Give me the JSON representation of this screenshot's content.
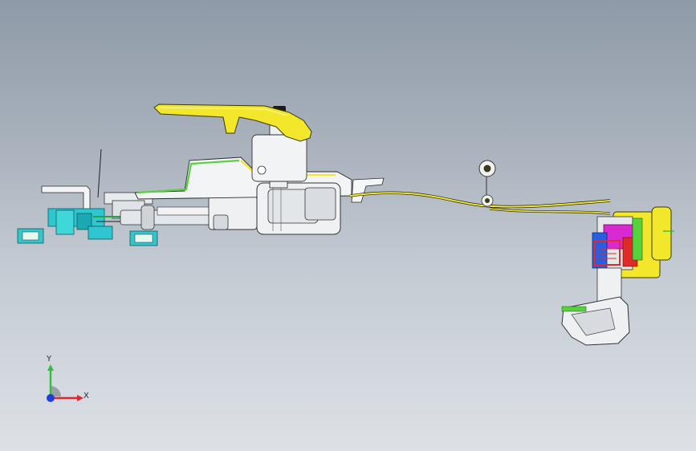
{
  "view": {
    "background_top": "#8f9aa8",
    "background_bottom": "#dde1e6"
  },
  "triad": {
    "y_label": "Y",
    "x_label": "X",
    "y_color": "#2fbf3a",
    "x_color": "#e0262e",
    "z_color": "#1f3fd6"
  },
  "model": {
    "primary_color": "#f2e72a",
    "accent_green": "#55d23c",
    "accent_cyan": "#2fc6cf",
    "accent_magenta": "#d92ad2",
    "accent_blue": "#2a5ee0",
    "accent_red": "#e02a2a",
    "housing_gray": "#e9ecef"
  }
}
